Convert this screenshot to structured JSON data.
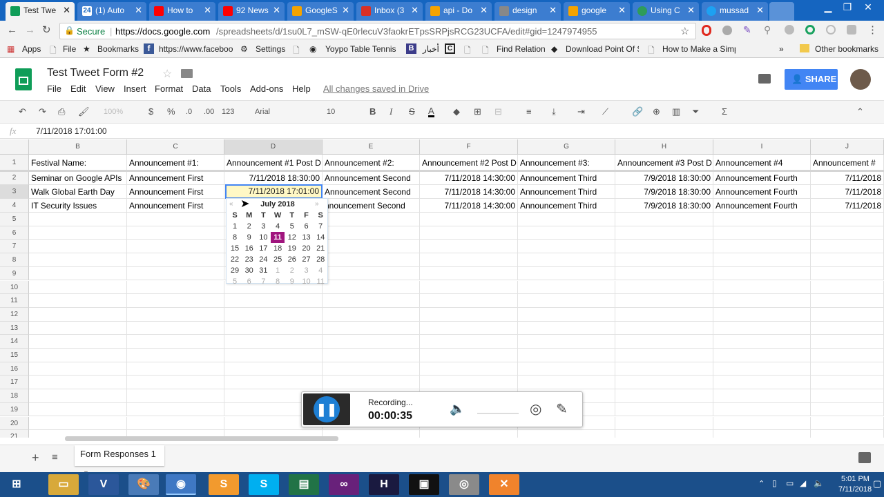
{
  "browser": {
    "tabs": [
      {
        "label": "Test Twe",
        "color": "#0f9d58",
        "active": true
      },
      {
        "label": "(1) Auto",
        "color": "#ffffff",
        "prefix": "24"
      },
      {
        "label": "How to",
        "color": "#ff0000"
      },
      {
        "label": "92 News",
        "color": "#ff0000"
      },
      {
        "label": "GoogleS",
        "color": "#f4a300"
      },
      {
        "label": "Inbox (3",
        "color": "#d93025"
      },
      {
        "label": "api - Do",
        "color": "#f4a300"
      },
      {
        "label": "design",
        "color": "#888888"
      },
      {
        "label": "google",
        "color": "#f4a300"
      },
      {
        "label": "Using C",
        "color": "#2e9c5a"
      },
      {
        "label": "mussad",
        "color": "#1da1f2"
      }
    ],
    "secure_label": "Secure",
    "url_domain": "https://docs.google.com",
    "url_path": "/spreadsheets/d/1su0L7_mSW-qE0rlecuV3faokrETpsSRPjsRCG23UCFA/edit#gid=1247974955",
    "bookmarks": [
      "Apps",
      "File",
      "Bookmarks",
      "https://www.faceboo",
      "Settings",
      "Yoypo Table Tennis",
      "أخبار",
      "Find Relation",
      "Download Point Of S",
      "How to Make a Simp",
      "Other bookmarks"
    ]
  },
  "doc": {
    "title": "Test Tweet Form #2",
    "menu": [
      "File",
      "Edit",
      "View",
      "Insert",
      "Format",
      "Data",
      "Tools",
      "Add-ons",
      "Help"
    ],
    "save_status": "All changes saved in Drive",
    "share_label": "SHARE"
  },
  "toolbar": {
    "zoom": "100%",
    "currency": "$",
    "percent": "%",
    "dec_less": ".0",
    "dec_more": ".00",
    "format_more": "123",
    "font": "Arial",
    "font_size": "10"
  },
  "formula": {
    "fx": "fx",
    "value": "7/11/2018 17:01:00"
  },
  "grid": {
    "columns": [
      "B",
      "C",
      "D",
      "E",
      "F",
      "G",
      "H",
      "I",
      "J"
    ],
    "rows": [
      "1",
      "2",
      "3",
      "4",
      "5",
      "6",
      "7",
      "8",
      "9",
      "10",
      "11",
      "12",
      "13",
      "14",
      "15",
      "16",
      "17",
      "18",
      "19",
      "20",
      "21"
    ],
    "headers": [
      "Festival Name:",
      "Announcement #1:",
      "Announcement #1 Post D",
      "Announcement #2:",
      "Announcement #2 Post D",
      "Announcement #3:",
      "Announcement #3 Post D",
      "Announcement #4",
      "Announcement #"
    ],
    "data": [
      [
        "Seminar on Google APIs",
        "Announcement First",
        "7/11/2018 18:30:00",
        "Announcement Second",
        "7/11/2018 14:30:00",
        "Announcement Third",
        "7/9/2018 18:30:00",
        "Announcement Fourth",
        "7/11/2018"
      ],
      [
        "Walk Global Earth Day",
        "Announcement First",
        "7/11/2018 17:01:00",
        "Announcement Second",
        "7/11/2018 14:30:00",
        "Announcement Third",
        "7/9/2018 18:30:00",
        "Announcement Fourth",
        "7/11/2018"
      ],
      [
        "IT Security Issues",
        "Announcement First",
        "",
        "nnouncement Second",
        "7/11/2018 14:30:00",
        "Announcement Third",
        "7/9/2018 18:30:00",
        "Announcement Fourth",
        "7/11/2018"
      ]
    ]
  },
  "calendar": {
    "prev": "«",
    "next": "»",
    "month": "July 2018",
    "weekdays": [
      "S",
      "M",
      "T",
      "W",
      "T",
      "F",
      "S"
    ],
    "weeks": [
      [
        "1",
        "2",
        "3",
        "4",
        "5",
        "6",
        "7"
      ],
      [
        "8",
        "9",
        "10",
        "11",
        "12",
        "13",
        "14"
      ],
      [
        "15",
        "16",
        "17",
        "18",
        "19",
        "20",
        "21"
      ],
      [
        "22",
        "23",
        "24",
        "25",
        "26",
        "27",
        "28"
      ],
      [
        "29",
        "30",
        "31",
        "1",
        "2",
        "3",
        "4"
      ],
      [
        "5",
        "6",
        "7",
        "8",
        "9",
        "10",
        "11"
      ]
    ],
    "selected_day": "11",
    "accent": "#a0157e"
  },
  "recorder": {
    "status": "Recording...",
    "time": "00:00:35"
  },
  "sheet_tabs": {
    "active": "Form Responses 1"
  },
  "taskbar": {
    "time": "5:01 PM",
    "date": "7/11/2018"
  }
}
